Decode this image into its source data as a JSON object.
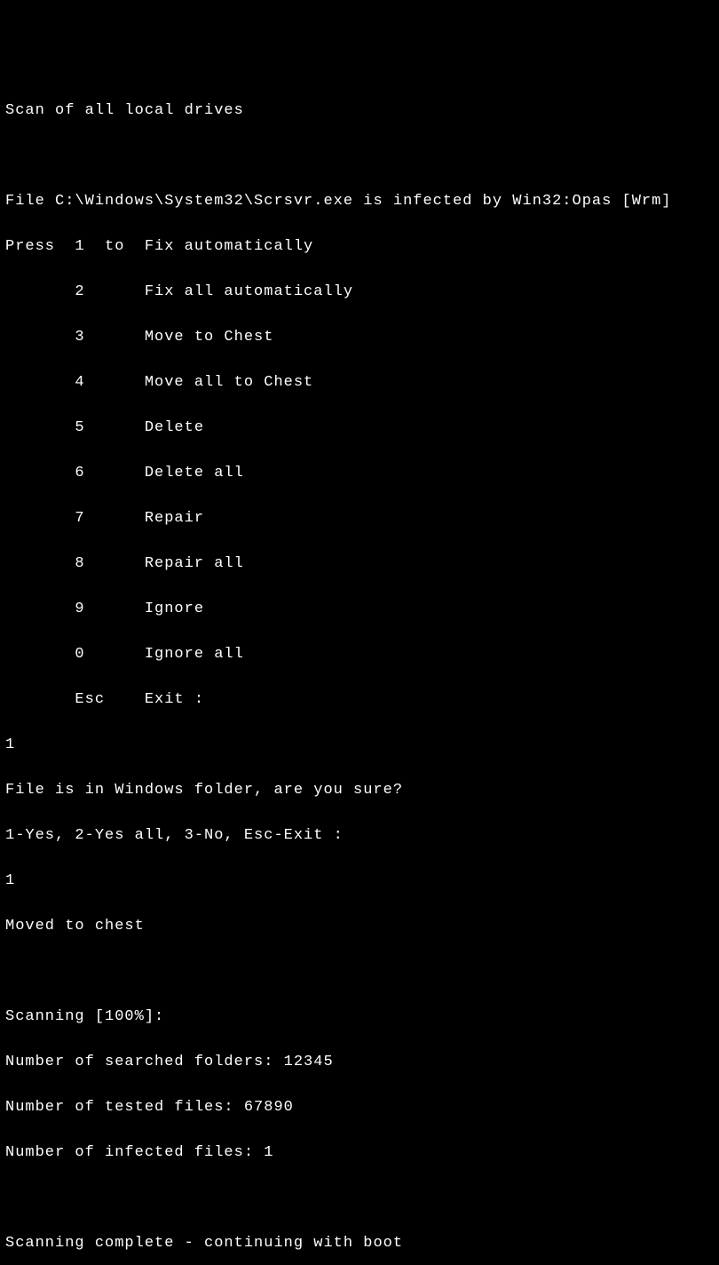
{
  "header": "Scan of all local drives",
  "infection_line": "File C:\\Windows\\System32\\Scrsvr.exe is infected by Win32:Opas [Wrm]",
  "menu_press": "Press  1  to  Fix automatically",
  "menu_items": {
    "k2": "       2      Fix all automatically",
    "k3": "       3      Move to Chest",
    "k4": "       4      Move all to Chest",
    "k5": "       5      Delete",
    "k6": "       6      Delete all",
    "k7": "       7      Repair",
    "k8": "       8      Repair all",
    "k9": "       9      Ignore",
    "k0": "       0      Ignore all",
    "kesc": "       Esc    Exit :"
  },
  "input1": "1",
  "confirm_prompt": "File is in Windows folder, are you sure?",
  "confirm_options": "1-Yes, 2-Yes all, 3-No, Esc-Exit :",
  "input2": "1",
  "result": "Moved to chest",
  "scan_progress": "Scanning [100%]:",
  "stats": {
    "folders": "Number of searched folders: 12345",
    "tested": "Number of tested files: 67890",
    "infected": "Number of infected files: 1"
  },
  "footer": "Scanning complete - continuing with boot"
}
